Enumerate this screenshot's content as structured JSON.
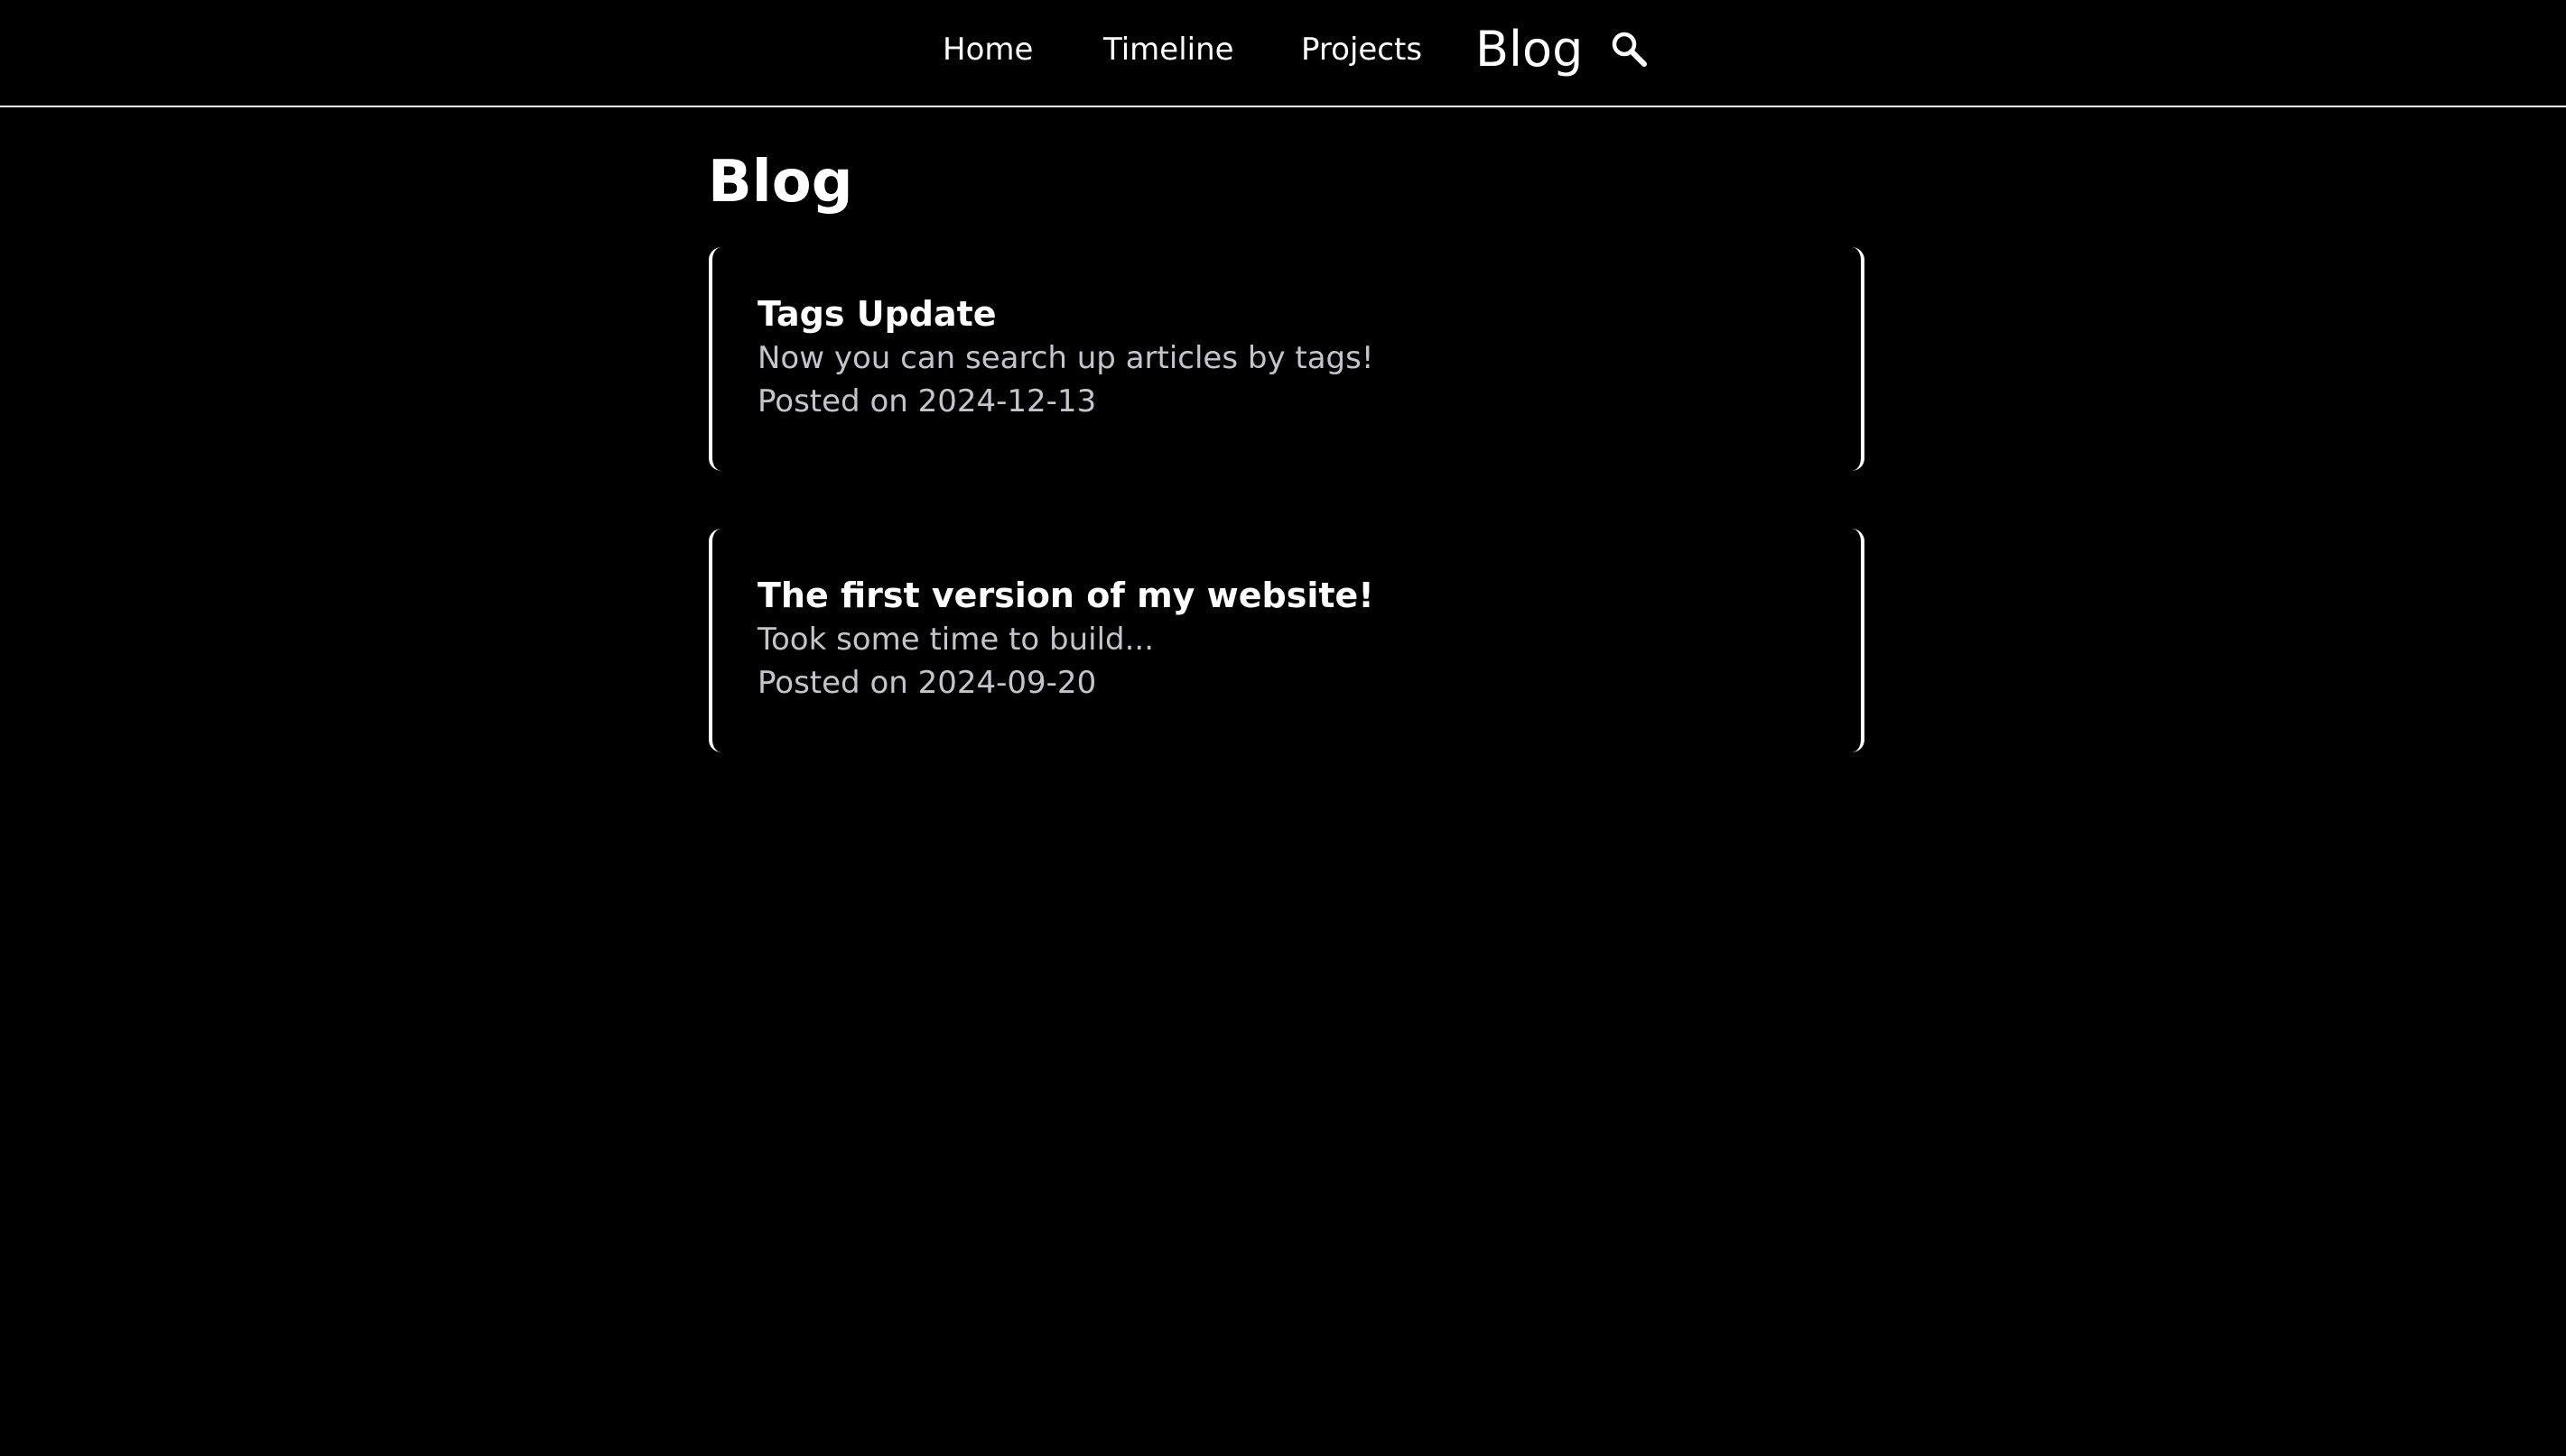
{
  "nav": {
    "home_label": "Home",
    "timeline_label": "Timeline",
    "projects_label": "Projects",
    "blog_label": "Blog",
    "search_icon": "search-icon"
  },
  "page": {
    "title": "Blog"
  },
  "posts": [
    {
      "title": "Tags Update",
      "description": "Now you can search up articles by tags!",
      "posted": "Posted on 2024-12-13"
    },
    {
      "title": "The first version of my website!",
      "description": "Took some time to build...",
      "posted": "Posted on 2024-09-20"
    }
  ],
  "colors": {
    "background": "#000000",
    "text": "#ffffff",
    "muted_text": "#c4c4cc",
    "border": "#ffffff"
  }
}
